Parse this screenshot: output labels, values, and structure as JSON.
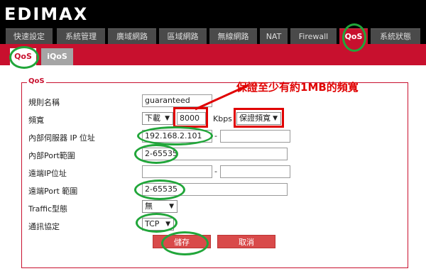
{
  "brand": {
    "logo_text": "EDIMAX"
  },
  "tabs": [
    {
      "label": "快速設定"
    },
    {
      "label": "系統管理"
    },
    {
      "label": "廣域網路"
    },
    {
      "label": "區域網路"
    },
    {
      "label": "無線網路"
    },
    {
      "label": "NAT"
    },
    {
      "label": "Firewall"
    },
    {
      "label": "QoS"
    },
    {
      "label": "系統狀態"
    }
  ],
  "subtabs": [
    {
      "label": "QoS"
    },
    {
      "label": "iQoS"
    }
  ],
  "form": {
    "legend": "QoS",
    "rule_name_label": "規則名稱",
    "rule_name_value": "guaranteed",
    "bandwidth_label": "頻寬",
    "direction_value": "下載",
    "bandwidth_value": "8000",
    "bandwidth_unit": "Kbps",
    "bandwidth_mode_value": "保證頻寬",
    "local_ip_label": "內部伺服器 IP 位址",
    "local_ip_start": "192.168.2.101",
    "local_ip_end": "",
    "local_port_label": "內部Port範圍",
    "local_port_value": "2-65535",
    "remote_ip_label": "遠端IP位址",
    "remote_ip_start": "",
    "remote_ip_end": "",
    "remote_port_label": "遠端Port 範圍",
    "remote_port_value": "2-65535",
    "traffic_type_label": "Traffic型態",
    "traffic_type_value": "無",
    "protocol_label": "通訊協定",
    "protocol_value": "TCP",
    "range_separator": "-"
  },
  "buttons": {
    "save": "儲存",
    "cancel": "取消"
  },
  "annotation": {
    "note": "保證至少有約1MB的頻寬"
  },
  "colors": {
    "brand_red": "#c8102e",
    "annotation_red": "#e00000",
    "annotation_green": "#21a63a"
  }
}
